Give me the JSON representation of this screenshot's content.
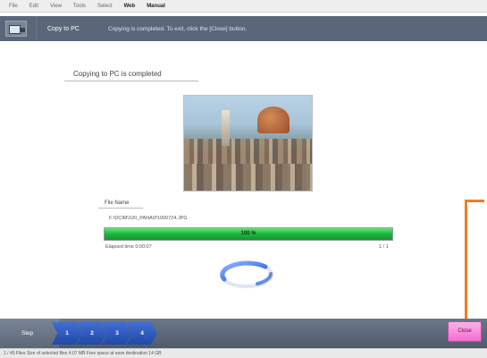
{
  "menubar": {
    "items": [
      {
        "label": "File",
        "bold": false
      },
      {
        "label": "Edit",
        "bold": false
      },
      {
        "label": "View",
        "bold": false
      },
      {
        "label": "Tools",
        "bold": false
      },
      {
        "label": "Select",
        "bold": false
      },
      {
        "label": "Web",
        "bold": true
      },
      {
        "label": "Manual",
        "bold": true
      }
    ]
  },
  "titlebar": {
    "title": "Copy to PC",
    "message": "Copying is completed. To exit, click the [Close] button."
  },
  "main": {
    "completed_title": "Copying to PC is completed",
    "file_name_label": "File Name",
    "file_path": "F:\\DCIM\\100_PANA\\P1000724.JPG",
    "progress_label": "100 %",
    "progress_fraction": 1.0,
    "elapsed_time": "Elapsed time 0:00:07",
    "file_count": "1 / 1"
  },
  "stepbar": {
    "label": "Step",
    "steps": [
      "1",
      "2",
      "3",
      "4"
    ]
  },
  "close_button": {
    "label": "Close"
  },
  "statusbar": {
    "text": "1 / 45 Files  Size of selected files 4.07 MB  Free space at save destination 14 GB"
  },
  "colors": {
    "titlebar": "#5a6778",
    "progress_fill": "#1db43e",
    "step_arrow": "#2f5fc4",
    "close_button": "#f36ad0",
    "callout": "#f07d22"
  },
  "icons": {
    "app_icon": "copy-to-pc-icon",
    "spinner": "loading-ring-icon"
  }
}
